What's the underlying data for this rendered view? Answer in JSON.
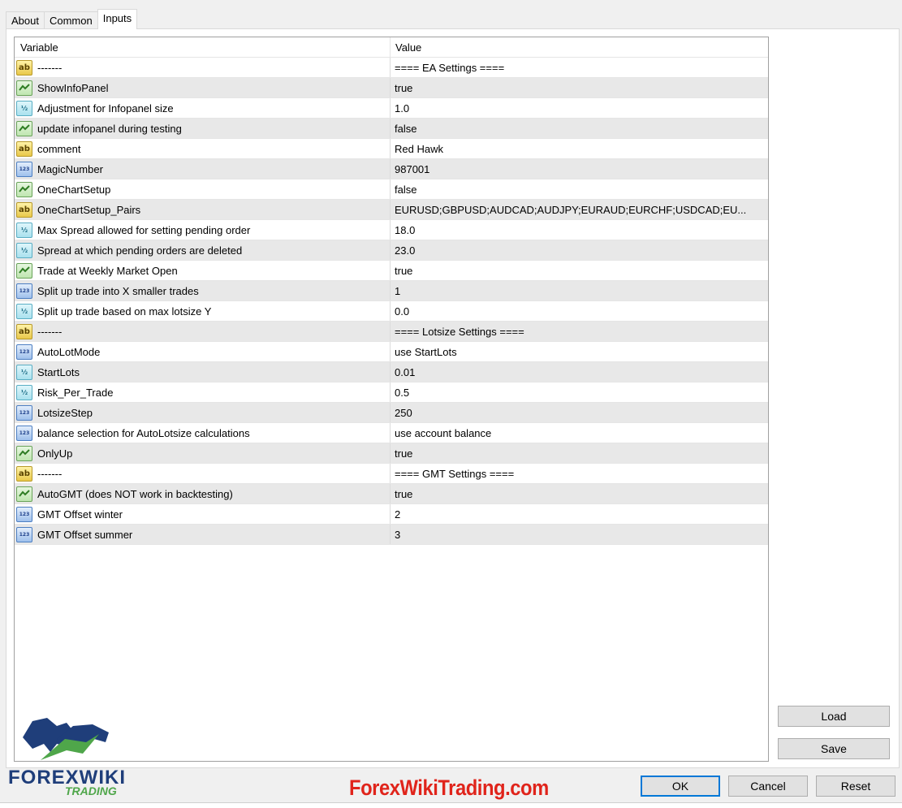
{
  "tabs": [
    {
      "label": "About",
      "active": false
    },
    {
      "label": "Common",
      "active": false
    },
    {
      "label": "Inputs",
      "active": true
    }
  ],
  "table": {
    "columns": [
      "Variable",
      "Value"
    ],
    "rows": [
      {
        "icon": "string-icon",
        "type": "string",
        "variable": "-------",
        "value": "==== EA Settings ===="
      },
      {
        "icon": "bool-icon",
        "type": "bool",
        "variable": "ShowInfoPanel",
        "value": "true"
      },
      {
        "icon": "double-icon",
        "type": "double",
        "variable": "Adjustment for Infopanel size",
        "value": "1.0"
      },
      {
        "icon": "bool-icon",
        "type": "bool",
        "variable": "update infopanel during testing",
        "value": "false"
      },
      {
        "icon": "string-icon",
        "type": "string",
        "variable": "comment",
        "value": "Red Hawk"
      },
      {
        "icon": "int-icon",
        "type": "int",
        "variable": "MagicNumber",
        "value": "987001"
      },
      {
        "icon": "bool-icon",
        "type": "bool",
        "variable": "OneChartSetup",
        "value": "false"
      },
      {
        "icon": "string-icon",
        "type": "string",
        "variable": "OneChartSetup_Pairs",
        "value": "EURUSD;GBPUSD;AUDCAD;AUDJPY;EURAUD;EURCHF;USDCAD;EU..."
      },
      {
        "icon": "double-icon",
        "type": "double",
        "variable": "Max Spread allowed for setting pending order",
        "value": "18.0"
      },
      {
        "icon": "double-icon",
        "type": "double",
        "variable": "Spread at which pending orders are deleted",
        "value": "23.0"
      },
      {
        "icon": "bool-icon",
        "type": "bool",
        "variable": "Trade at Weekly Market Open",
        "value": "true"
      },
      {
        "icon": "int-icon",
        "type": "int",
        "variable": "Split up trade into X smaller trades",
        "value": "1"
      },
      {
        "icon": "double-icon",
        "type": "double",
        "variable": "Split up trade based on max lotsize Y",
        "value": "0.0"
      },
      {
        "icon": "string-icon",
        "type": "string",
        "variable": "-------",
        "value": "==== Lotsize Settings ===="
      },
      {
        "icon": "int-icon",
        "type": "int",
        "variable": "AutoLotMode",
        "value": "use StartLots"
      },
      {
        "icon": "double-icon",
        "type": "double",
        "variable": "StartLots",
        "value": "0.01"
      },
      {
        "icon": "double-icon",
        "type": "double",
        "variable": "Risk_Per_Trade",
        "value": "0.5"
      },
      {
        "icon": "int-icon",
        "type": "int",
        "variable": "LotsizeStep",
        "value": "250"
      },
      {
        "icon": "int-icon",
        "type": "int",
        "variable": "balance selection for AutoLotsize calculations",
        "value": "use account balance"
      },
      {
        "icon": "bool-icon",
        "type": "bool",
        "variable": "OnlyUp",
        "value": "true"
      },
      {
        "icon": "string-icon",
        "type": "string",
        "variable": "-------",
        "value": "==== GMT Settings ===="
      },
      {
        "icon": "bool-icon",
        "type": "bool",
        "variable": "AutoGMT (does NOT work in backtesting)",
        "value": "true"
      },
      {
        "icon": "int-icon",
        "type": "int",
        "variable": "GMT Offset winter",
        "value": "2"
      },
      {
        "icon": "int-icon",
        "type": "int",
        "variable": "GMT Offset summer",
        "value": "3"
      }
    ]
  },
  "icons": {
    "string": "ab",
    "double": "½",
    "int": "123"
  },
  "buttons": {
    "load": "Load",
    "save": "Save",
    "ok": "OK",
    "cancel": "Cancel",
    "reset": "Reset"
  },
  "watermark": {
    "logo_main": "FOREXWIKI",
    "logo_sub": "TRADING",
    "site": "ForexWikiTrading.com"
  },
  "colors": {
    "primary_border": "#0078d7",
    "watermark_red": "#e0241b",
    "logo_blue": "#1f3e7a",
    "logo_green": "#4fa64a"
  }
}
